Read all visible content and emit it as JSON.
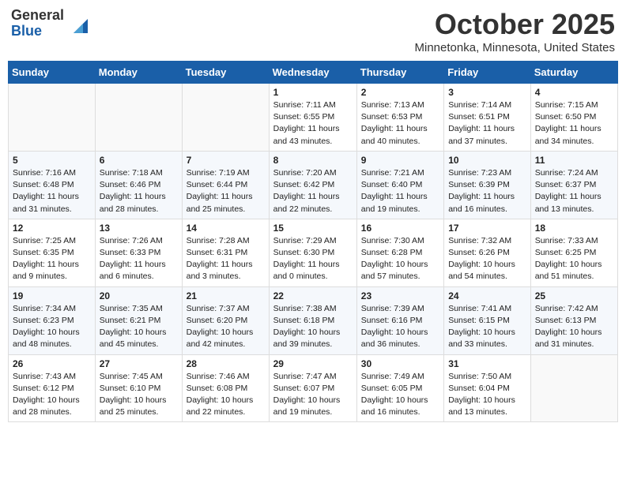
{
  "header": {
    "logo_general": "General",
    "logo_blue": "Blue",
    "month": "October 2025",
    "location": "Minnetonka, Minnesota, United States"
  },
  "days_of_week": [
    "Sunday",
    "Monday",
    "Tuesday",
    "Wednesday",
    "Thursday",
    "Friday",
    "Saturday"
  ],
  "weeks": [
    [
      {
        "day": "",
        "info": ""
      },
      {
        "day": "",
        "info": ""
      },
      {
        "day": "",
        "info": ""
      },
      {
        "day": "1",
        "info": "Sunrise: 7:11 AM\nSunset: 6:55 PM\nDaylight: 11 hours and 43 minutes."
      },
      {
        "day": "2",
        "info": "Sunrise: 7:13 AM\nSunset: 6:53 PM\nDaylight: 11 hours and 40 minutes."
      },
      {
        "day": "3",
        "info": "Sunrise: 7:14 AM\nSunset: 6:51 PM\nDaylight: 11 hours and 37 minutes."
      },
      {
        "day": "4",
        "info": "Sunrise: 7:15 AM\nSunset: 6:50 PM\nDaylight: 11 hours and 34 minutes."
      }
    ],
    [
      {
        "day": "5",
        "info": "Sunrise: 7:16 AM\nSunset: 6:48 PM\nDaylight: 11 hours and 31 minutes."
      },
      {
        "day": "6",
        "info": "Sunrise: 7:18 AM\nSunset: 6:46 PM\nDaylight: 11 hours and 28 minutes."
      },
      {
        "day": "7",
        "info": "Sunrise: 7:19 AM\nSunset: 6:44 PM\nDaylight: 11 hours and 25 minutes."
      },
      {
        "day": "8",
        "info": "Sunrise: 7:20 AM\nSunset: 6:42 PM\nDaylight: 11 hours and 22 minutes."
      },
      {
        "day": "9",
        "info": "Sunrise: 7:21 AM\nSunset: 6:40 PM\nDaylight: 11 hours and 19 minutes."
      },
      {
        "day": "10",
        "info": "Sunrise: 7:23 AM\nSunset: 6:39 PM\nDaylight: 11 hours and 16 minutes."
      },
      {
        "day": "11",
        "info": "Sunrise: 7:24 AM\nSunset: 6:37 PM\nDaylight: 11 hours and 13 minutes."
      }
    ],
    [
      {
        "day": "12",
        "info": "Sunrise: 7:25 AM\nSunset: 6:35 PM\nDaylight: 11 hours and 9 minutes."
      },
      {
        "day": "13",
        "info": "Sunrise: 7:26 AM\nSunset: 6:33 PM\nDaylight: 11 hours and 6 minutes."
      },
      {
        "day": "14",
        "info": "Sunrise: 7:28 AM\nSunset: 6:31 PM\nDaylight: 11 hours and 3 minutes."
      },
      {
        "day": "15",
        "info": "Sunrise: 7:29 AM\nSunset: 6:30 PM\nDaylight: 11 hours and 0 minutes."
      },
      {
        "day": "16",
        "info": "Sunrise: 7:30 AM\nSunset: 6:28 PM\nDaylight: 10 hours and 57 minutes."
      },
      {
        "day": "17",
        "info": "Sunrise: 7:32 AM\nSunset: 6:26 PM\nDaylight: 10 hours and 54 minutes."
      },
      {
        "day": "18",
        "info": "Sunrise: 7:33 AM\nSunset: 6:25 PM\nDaylight: 10 hours and 51 minutes."
      }
    ],
    [
      {
        "day": "19",
        "info": "Sunrise: 7:34 AM\nSunset: 6:23 PM\nDaylight: 10 hours and 48 minutes."
      },
      {
        "day": "20",
        "info": "Sunrise: 7:35 AM\nSunset: 6:21 PM\nDaylight: 10 hours and 45 minutes."
      },
      {
        "day": "21",
        "info": "Sunrise: 7:37 AM\nSunset: 6:20 PM\nDaylight: 10 hours and 42 minutes."
      },
      {
        "day": "22",
        "info": "Sunrise: 7:38 AM\nSunset: 6:18 PM\nDaylight: 10 hours and 39 minutes."
      },
      {
        "day": "23",
        "info": "Sunrise: 7:39 AM\nSunset: 6:16 PM\nDaylight: 10 hours and 36 minutes."
      },
      {
        "day": "24",
        "info": "Sunrise: 7:41 AM\nSunset: 6:15 PM\nDaylight: 10 hours and 33 minutes."
      },
      {
        "day": "25",
        "info": "Sunrise: 7:42 AM\nSunset: 6:13 PM\nDaylight: 10 hours and 31 minutes."
      }
    ],
    [
      {
        "day": "26",
        "info": "Sunrise: 7:43 AM\nSunset: 6:12 PM\nDaylight: 10 hours and 28 minutes."
      },
      {
        "day": "27",
        "info": "Sunrise: 7:45 AM\nSunset: 6:10 PM\nDaylight: 10 hours and 25 minutes."
      },
      {
        "day": "28",
        "info": "Sunrise: 7:46 AM\nSunset: 6:08 PM\nDaylight: 10 hours and 22 minutes."
      },
      {
        "day": "29",
        "info": "Sunrise: 7:47 AM\nSunset: 6:07 PM\nDaylight: 10 hours and 19 minutes."
      },
      {
        "day": "30",
        "info": "Sunrise: 7:49 AM\nSunset: 6:05 PM\nDaylight: 10 hours and 16 minutes."
      },
      {
        "day": "31",
        "info": "Sunrise: 7:50 AM\nSunset: 6:04 PM\nDaylight: 10 hours and 13 minutes."
      },
      {
        "day": "",
        "info": ""
      }
    ]
  ]
}
